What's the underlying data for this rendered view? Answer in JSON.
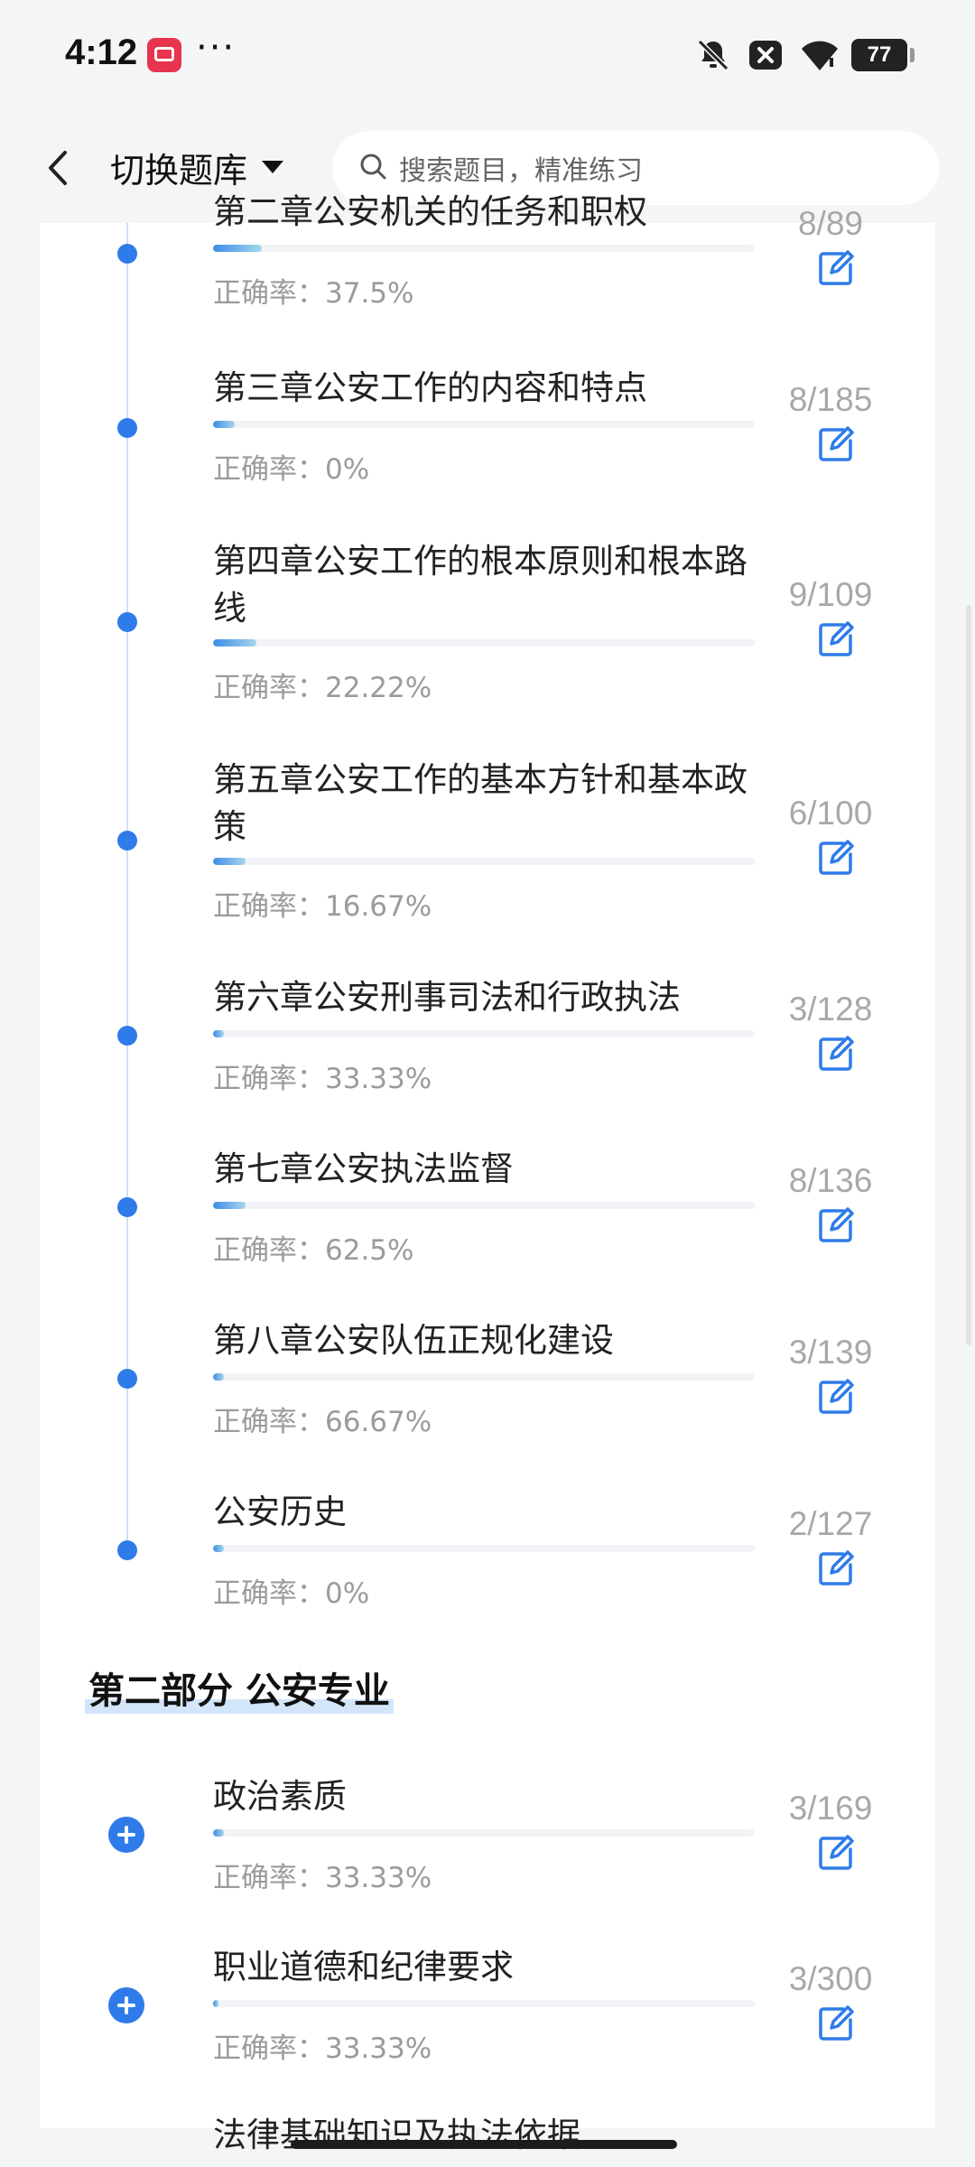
{
  "status_bar": {
    "time": "4:12",
    "more": "···",
    "battery": "77"
  },
  "header": {
    "switch_bank_label": "切换题库",
    "search_placeholder": "搜索题目，精准练习"
  },
  "part1_items": [
    {
      "title": "第二章公安机关的任务和职权",
      "count": "8/89",
      "rate": "正确率：37.5%",
      "progress": 0.09
    },
    {
      "title": "第三章公安工作的内容和特点",
      "count": "8/185",
      "rate": "正确率：0%",
      "progress": 0.04
    },
    {
      "title": "第四章公安工作的根本原则和根本路线",
      "count": "9/109",
      "rate": "正确率：22.22%",
      "progress": 0.08
    },
    {
      "title": "第五章公安工作的基本方针和基本政策",
      "count": "6/100",
      "rate": "正确率：16.67%",
      "progress": 0.06
    },
    {
      "title": "第六章公安刑事司法和行政执法",
      "count": "3/128",
      "rate": "正确率：33.33%",
      "progress": 0.02
    },
    {
      "title": "第七章公安执法监督",
      "count": "8/136",
      "rate": "正确率：62.5%",
      "progress": 0.06
    },
    {
      "title": "第八章公安队伍正规化建设",
      "count": "3/139",
      "rate": "正确率：66.67%",
      "progress": 0.02
    },
    {
      "title": "公安历史",
      "count": "2/127",
      "rate": "正确率：0%",
      "progress": 0.02
    }
  ],
  "section2": {
    "title": "第二部分 公安专业"
  },
  "part2_items": [
    {
      "title": "政治素质",
      "count": "3/169",
      "rate": "正确率：33.33%",
      "progress": 0.02
    },
    {
      "title": "职业道德和纪律要求",
      "count": "3/300",
      "rate": "正确率：33.33%",
      "progress": 0.01
    },
    {
      "title": "法律基础知识及执法依据"
    }
  ],
  "colors": {
    "accent": "#2f7be9",
    "progress_start": "#3c8de6",
    "progress_end": "#a7d6ee",
    "muted_text": "#9b9b9b"
  }
}
